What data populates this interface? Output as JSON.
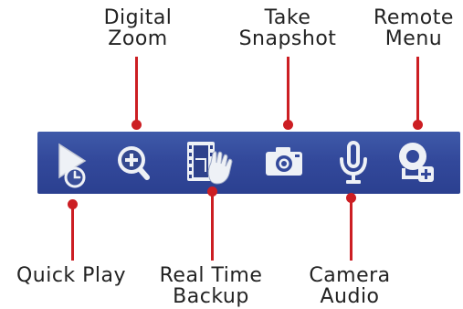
{
  "annotations": {
    "digital_zoom": [
      "Digital",
      "Zoom"
    ],
    "take_snapshot": [
      "Take",
      "Snapshot"
    ],
    "remote_menu": [
      "Remote",
      "Menu"
    ],
    "quick_play": [
      "Quick Play"
    ],
    "real_time_backup": [
      "Real Time",
      "Backup"
    ],
    "camera_audio": [
      "Camera",
      "Audio"
    ]
  },
  "toolbar": {
    "buttons": [
      {
        "name": "quick-play",
        "icon": "play-clock-icon"
      },
      {
        "name": "digital-zoom",
        "icon": "zoom-in-icon"
      },
      {
        "name": "real-time-backup",
        "icon": "film-hand-icon"
      },
      {
        "name": "take-snapshot",
        "icon": "camera-icon"
      },
      {
        "name": "camera-audio",
        "icon": "microphone-icon"
      },
      {
        "name": "remote-menu",
        "icon": "remote-add-icon"
      }
    ]
  },
  "colors": {
    "toolbar": "#33499b",
    "leader": "#cc1e23",
    "icon": "#eef1f6",
    "text": "#222222"
  }
}
